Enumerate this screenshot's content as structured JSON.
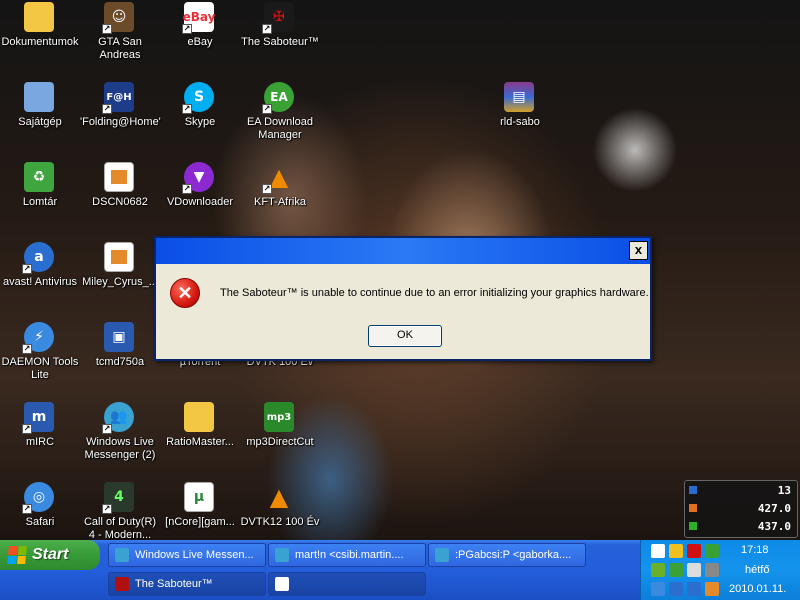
{
  "desktop_icons": [
    {
      "label": "Dokumentumok",
      "icon": "folder-icon",
      "color": "#f3c744"
    },
    {
      "label": "GTA San Andreas",
      "icon": "gta-icon",
      "color": "#6b4b2a"
    },
    {
      "label": "eBay",
      "icon": "ebay-icon",
      "color": "#e53238"
    },
    {
      "label": "The Saboteur™",
      "icon": "saboteur-icon",
      "color": "#b01010"
    },
    {
      "label": "Sajátgép",
      "icon": "computer-icon",
      "color": "#7aa7e0"
    },
    {
      "label": "'Folding@Home'",
      "icon": "folding-icon",
      "color": "#1f3c8a"
    },
    {
      "label": "Skype",
      "icon": "skype-icon",
      "color": "#00aff0"
    },
    {
      "label": "EA Download Manager",
      "icon": "ea-icon",
      "color": "#3aa235"
    },
    {
      "label": "rld-sabo",
      "icon": "winrar-icon",
      "color": "#8a3a8a"
    },
    {
      "label": "Lomtár",
      "icon": "recycle-bin-icon",
      "color": "#3fa63f"
    },
    {
      "label": "DSCN0682",
      "icon": "image-file-icon",
      "color": "#e58a2a"
    },
    {
      "label": "VDownloader",
      "icon": "vdownloader-icon",
      "color": "#8a2ad0"
    },
    {
      "label": "KFT-Afrika",
      "icon": "vlc-icon",
      "color": "#f08a00"
    },
    {
      "label": "avast! Antivirus",
      "icon": "avast-icon",
      "color": "#2a6fd0"
    },
    {
      "label": "Miley_Cyrus_...",
      "icon": "image-file-icon",
      "color": "#e58a2a"
    },
    {
      "label": "DAEMON Tools Lite",
      "icon": "daemon-tools-icon",
      "color": "#3a8ae0"
    },
    {
      "label": "tcmd750a",
      "icon": "floppy-icon",
      "color": "#2a5ab0"
    },
    {
      "label": "µTorrent",
      "icon": "utorrent-icon",
      "color": "#6ab02a"
    },
    {
      "label": "DVTK 100 Év",
      "icon": "vlc-icon",
      "color": "#f08a00"
    },
    {
      "label": "mIRC",
      "icon": "mirc-icon",
      "color": "#2a5ab0"
    },
    {
      "label": "Windows Live Messenger (2)",
      "icon": "messenger-icon",
      "color": "#3aa2d0"
    },
    {
      "label": "RatioMaster...",
      "icon": "folder-icon",
      "color": "#f3c744"
    },
    {
      "label": "mp3DirectCut",
      "icon": "mp3directcut-icon",
      "color": "#2a8a2a"
    },
    {
      "label": "Safari",
      "icon": "safari-icon",
      "color": "#3a8ae0"
    },
    {
      "label": "Call of Duty(R) 4 - Modern...",
      "icon": "cod-icon",
      "color": "#2a3a2a"
    },
    {
      "label": "[nCore][gam...",
      "icon": "utorrent-file-icon",
      "color": "#2a8a3a"
    },
    {
      "label": "DVTK12 100 Év",
      "icon": "vlc-icon",
      "color": "#f08a00"
    }
  ],
  "dialog": {
    "message": "The Saboteur™ is unable to continue due to an error initializing your graphics hardware.",
    "ok_label": "OK",
    "close_label": "x"
  },
  "gadget": {
    "v1": "13",
    "v2": "427.0",
    "v3": "437.0"
  },
  "taskbar": {
    "start_label": "Start",
    "buttons": [
      {
        "label": "Windows Live Messen...",
        "icon": "messenger-icon"
      },
      {
        "label": "mart!n <csibi.martin....",
        "icon": "messenger-chat-icon"
      },
      {
        "label": ":PGabcsi:P <gaborka....",
        "icon": "messenger-chat-icon"
      },
      {
        "label": "The Saboteur™",
        "icon": "saboteur-icon"
      },
      {
        "label": "",
        "icon": "window-icon"
      }
    ],
    "clock": {
      "time": "17:18",
      "day": "hétfő",
      "date": "2010.01.11."
    }
  }
}
